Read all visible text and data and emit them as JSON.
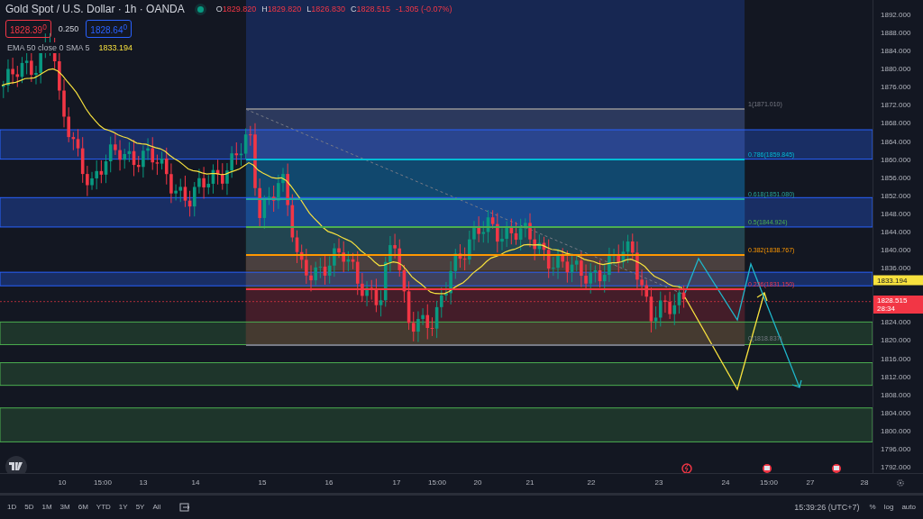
{
  "header": {
    "symbol": "Gold Spot / U.S. Dollar · 1h · OANDA",
    "market_open": true,
    "ohlc": [
      {
        "key": "O",
        "value": "1829.820"
      },
      {
        "key": "H",
        "value": "1829.820"
      },
      {
        "key": "L",
        "value": "1826.830"
      },
      {
        "key": "C",
        "value": "1828.515"
      }
    ],
    "change": "-1.305 (-0.07%)",
    "sell": "1828.39$^{0}$",
    "spread": "0.250",
    "buy": "1828.64$^{0}$"
  },
  "indicator": {
    "name": "EMA 50 close 0 SMA 5",
    "value": "1833.194"
  },
  "fib_levels": [
    {
      "label": "1(1871.010)",
      "color": "#787b86"
    },
    {
      "label": "0.786(1859.845)",
      "color": "#00bcd4"
    },
    {
      "label": "0.618(1851.080)",
      "color": "#26a69a"
    },
    {
      "label": "0.5(1844.924)",
      "color": "#4caf50"
    },
    {
      "label": "0.382(1838.767)",
      "color": "#ff9800"
    },
    {
      "label": "0.236(1831.150)",
      "color": "#f23645"
    },
    {
      "label": "0(1818.837)",
      "color": "#787b86"
    }
  ],
  "price_axis": [
    "1892.000",
    "1888.000",
    "1884.000",
    "1880.000",
    "1876.000",
    "1872.000",
    "1868.000",
    "1864.000",
    "1860.000",
    "1856.000",
    "1852.000",
    "1848.000",
    "1844.000",
    "1840.000",
    "1836.000",
    "1824.000",
    "1820.000",
    "1816.000",
    "1812.000",
    "1808.000",
    "1804.000",
    "1800.000",
    "1796.000",
    "1792.000"
  ],
  "ema_tag": "1833.194",
  "price_tag": {
    "price": "1828.515",
    "countdown": "28:34"
  },
  "time_axis": [
    "10",
    "15:00",
    "13",
    "14",
    "15",
    "16",
    "17",
    "15:00",
    "20",
    "21",
    "22",
    "23",
    "24",
    "15:00",
    "27",
    "28"
  ],
  "ranges": [
    "1D",
    "5D",
    "1M",
    "3M",
    "6M",
    "YTD",
    "1Y",
    "5Y",
    "All"
  ],
  "clock": "15:39:26 (UTC+7)",
  "scale_options": [
    "%",
    "log",
    "auto"
  ]
}
